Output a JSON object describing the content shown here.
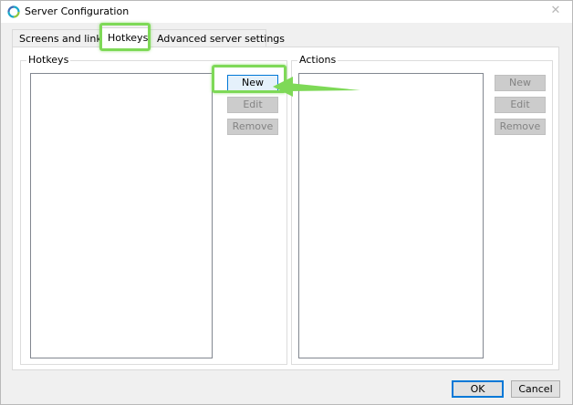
{
  "window": {
    "title": "Server Configuration",
    "close_glyph": "✕",
    "icon": "app-ring-icon"
  },
  "tabs": [
    {
      "label": "Screens and links",
      "active": false
    },
    {
      "label": "Hotkeys",
      "active": true
    },
    {
      "label": "Advanced server settings",
      "active": false
    }
  ],
  "hotkeys_group": {
    "label": "Hotkeys",
    "buttons": {
      "new": "New",
      "edit": "Edit",
      "remove": "Remove"
    }
  },
  "actions_group": {
    "label": "Actions",
    "buttons": {
      "new": "New",
      "edit": "Edit",
      "remove": "Remove"
    }
  },
  "dialog_buttons": {
    "ok": "OK",
    "cancel": "Cancel"
  },
  "colors": {
    "highlight": "#7ed957",
    "focus_blue": "#0078d7",
    "icon_cyan": "#1aa7c9",
    "icon_green": "#8cc63f"
  }
}
